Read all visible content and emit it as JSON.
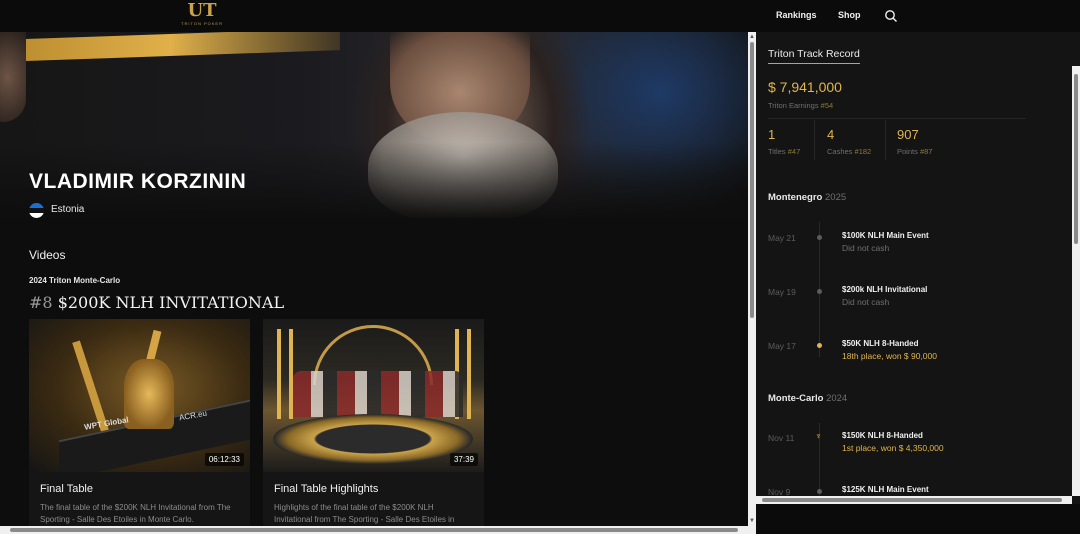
{
  "header": {
    "logo_mark": "UT",
    "logo_sub": "TRITON POKER",
    "nav": [
      "Rankings",
      "Shop"
    ],
    "search_icon": "search-icon"
  },
  "player": {
    "name": "VLADIMIR KORZININ",
    "country": "Estonia",
    "flag_icon": "estonia-flag-icon"
  },
  "videos": {
    "heading": "Videos",
    "event_sub": "2024 Triton Monte-Carlo",
    "event_num": "#8",
    "event_title": "$200K NLH INVITATIONAL",
    "items": [
      {
        "title": "Final Table",
        "duration": "06:12:33",
        "description": "The final table of the $200K NLH Invitational from The Sporting - Salle Des Etoiles in Monte Carlo.",
        "thumb_text_1": "WPT Global",
        "thumb_text_2": "ACR.eu"
      },
      {
        "title": "Final Table Highlights",
        "duration": "37:39",
        "description": "Highlights of the final table of the $200K NLH Invitational from The Sporting - Salle Des Etoiles in"
      }
    ]
  },
  "track_record": {
    "title": "Triton Track Record",
    "earnings": "$ 7,941,000",
    "earnings_label": "Triton Earnings",
    "earnings_rank": "#54",
    "stats": [
      {
        "value": "1",
        "label": "Titles",
        "rank": "#47"
      },
      {
        "value": "4",
        "label": "Cashes",
        "rank": "#182"
      },
      {
        "value": "907",
        "label": "Points",
        "rank": "#87"
      }
    ],
    "groups": [
      {
        "name": "Montenegro",
        "year": "2025",
        "results": [
          {
            "date": "May 21",
            "event": "$100K NLH Main Event",
            "result": "Did not cash",
            "highlight": false
          },
          {
            "date": "May 19",
            "event": "$200k NLH Invitational",
            "result": "Did not cash",
            "highlight": false
          },
          {
            "date": "May 17",
            "event": "$50K NLH 8-Handed",
            "result": "18th place, won $ 90,000",
            "highlight": true
          }
        ]
      },
      {
        "name": "Monte-Carlo",
        "year": "2024",
        "results": [
          {
            "date": "Nov 11",
            "event": "$150K NLH 8-Handed",
            "result": "1st place, won $ 4,350,000",
            "highlight": true
          },
          {
            "date": "Nov 9",
            "event": "$125K NLH Main Event",
            "result": "",
            "highlight": false
          }
        ]
      }
    ]
  }
}
